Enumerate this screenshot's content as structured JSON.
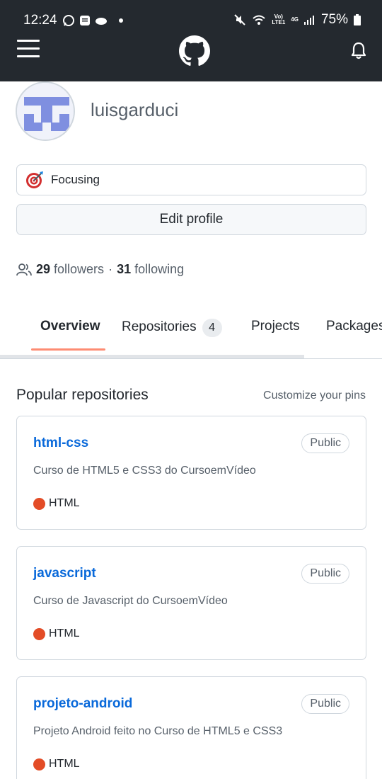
{
  "status_bar": {
    "time": "12:24",
    "battery": "75%",
    "net_top": "Vo)",
    "net_bottom": "LTE1",
    "gen": "4G"
  },
  "profile": {
    "username": "luisgarduci",
    "status_text": "Focusing",
    "edit_label": "Edit profile",
    "followers_count": "29",
    "followers_label": "followers",
    "separator": "·",
    "following_count": "31",
    "following_label": "following"
  },
  "tabs": [
    {
      "label": "Overview"
    },
    {
      "label": "Repositories",
      "count": "4"
    },
    {
      "label": "Projects"
    },
    {
      "label": "Packages"
    }
  ],
  "popular": {
    "title": "Popular repositories",
    "customize": "Customize your pins",
    "repos": [
      {
        "name": "html-css",
        "visibility": "Public",
        "description": "Curso de HTML5 e CSS3 do CursoemVídeo",
        "language": "HTML",
        "language_color": "#e34c26"
      },
      {
        "name": "javascript",
        "visibility": "Public",
        "description": "Curso de Javascript do CursoemVídeo",
        "language": "HTML",
        "language_color": "#e34c26"
      },
      {
        "name": "projeto-android",
        "visibility": "Public",
        "description": "Projeto Android feito no Curso de HTML5 e CSS3",
        "language": "HTML",
        "language_color": "#e34c26"
      }
    ]
  },
  "icons": {
    "menu": "hamburger-menu-icon",
    "logo": "github-logo",
    "notifications": "bell-icon",
    "status": "target-emoji",
    "people": "people-icon"
  }
}
